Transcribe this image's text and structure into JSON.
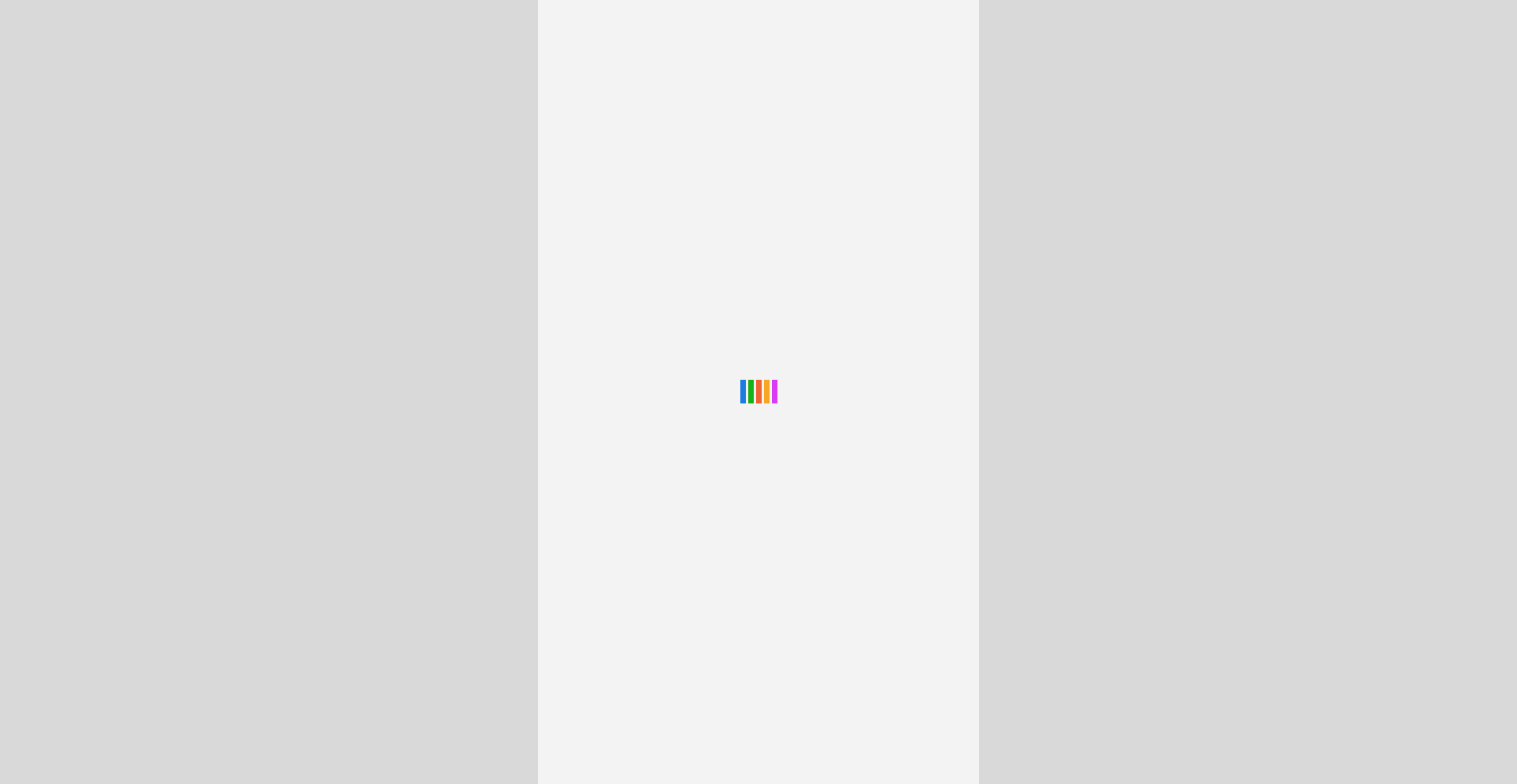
{
  "page": {
    "background_color": "#d9d9d9",
    "content_background_color": "#f3f3f3"
  },
  "loading_indicator": {
    "bars": [
      {
        "color": "#1e7be0"
      },
      {
        "color": "#1ab01a"
      },
      {
        "color": "#f0652f"
      },
      {
        "color": "#f5a623"
      },
      {
        "color": "#d93bf3"
      }
    ]
  }
}
